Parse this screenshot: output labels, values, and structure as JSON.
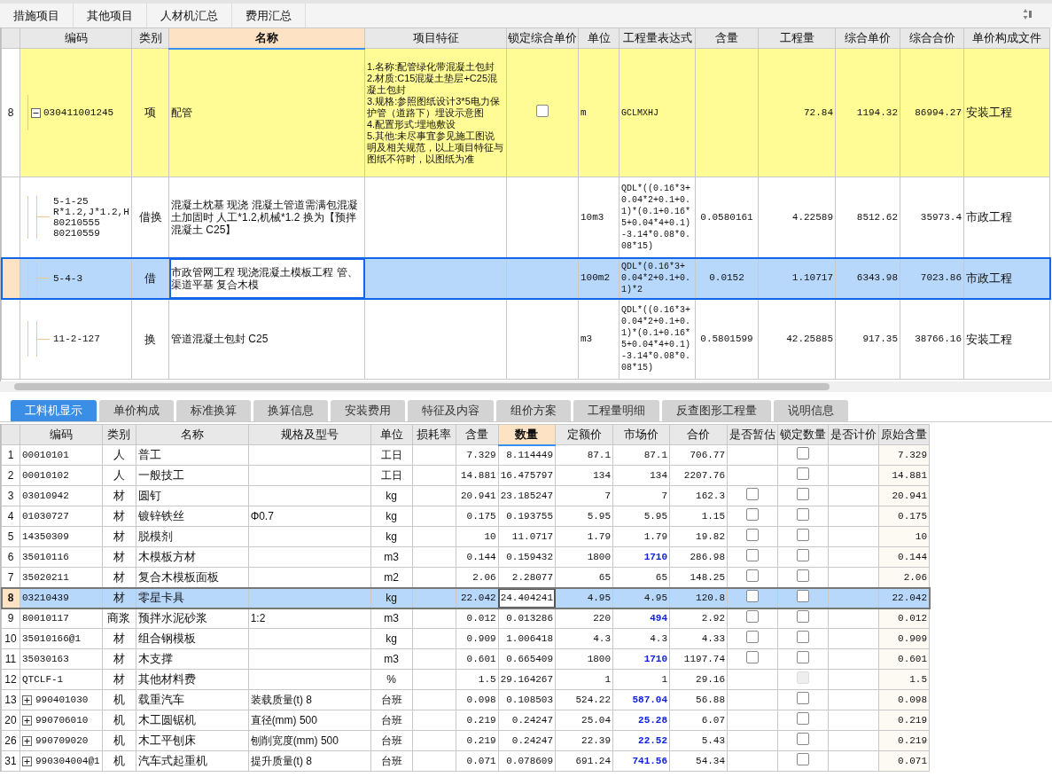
{
  "top_tabs": [
    "措施项目",
    "其他项目",
    "人材机汇总",
    "费用汇总"
  ],
  "main_table": {
    "columns": [
      {
        "label": "编码",
        "active": false
      },
      {
        "label": "类别",
        "active": false
      },
      {
        "label": "名称",
        "active": true
      },
      {
        "label": "项目特征",
        "active": false
      },
      {
        "label": "锁定综合单价",
        "active": false
      },
      {
        "label": "单位",
        "active": false
      },
      {
        "label": "工程量表达式",
        "active": false
      },
      {
        "label": "含量",
        "active": false
      },
      {
        "label": "工程量",
        "active": false
      },
      {
        "label": "综合单价",
        "active": false
      },
      {
        "label": "综合合价",
        "active": false
      },
      {
        "label": "单价构成文件",
        "active": false
      }
    ],
    "rows": [
      {
        "kind": "item",
        "selected": false,
        "row_number": "8",
        "expanded": true,
        "code": "030411001245",
        "type": "项",
        "name": "配管",
        "feature": "1.名称:配管绿化带混凝土包封\n2.材质:C15混凝土垫层+C25混凝土包封\n3.规格:参照图纸设计3*5电力保护管（道路下）埋设示意图\n4.配置形式:埋地敷设\n5.其他:未尽事宜参见施工图说明及相关规范，以上项目特征与图纸不符时，以图纸为准",
        "locked": false,
        "unit": "m",
        "expression": "GCLMXHJ",
        "quantity": "72.84",
        "unit_price": "1194.32",
        "total": "86994.27",
        "file": "安装工程"
      },
      {
        "kind": "sub",
        "selected": false,
        "code": "5-1-25\nR*1.2,J*1.2,H\n80210555\n80210559",
        "type": "借换",
        "name": "混凝土枕基 现浇  混凝土管道需满包混凝土加固时 人工*1.2,机械*1.2  换为【预拌混凝土 C25】",
        "unit": "10m3",
        "expression": "QDL*((0.16*3+0.04*2+0.1+0.1)*(0.1+0.16*5+0.04*4+0.1)-3.14*0.08*0.08*15)",
        "content": "0.0580161",
        "quantity": "4.22589",
        "unit_price": "8512.62",
        "total": "35973.4",
        "file": "市政工程"
      },
      {
        "kind": "sub",
        "selected": true,
        "code": "5-4-3",
        "type": "借",
        "name": "市政管网工程 现浇混凝土模板工程 管、渠道平基 复合木模",
        "unit": "100m2",
        "expression": "QDL*(0.16*3+0.04*2+0.1+0.1)*2",
        "content": "0.0152",
        "quantity": "1.10717",
        "unit_price": "6343.98",
        "total": "7023.86",
        "file": "市政工程"
      },
      {
        "kind": "sub",
        "selected": false,
        "code": "11-2-127",
        "type": "换",
        "name": "管道混凝土包封 C25",
        "unit": "m3",
        "expression": "QDL*((0.16*3+0.04*2+0.1+0.1)*(0.1+0.16*5+0.04*4+0.1)-3.14*0.08*0.08*15)",
        "content": "0.5801599",
        "quantity": "42.25885",
        "unit_price": "917.35",
        "total": "38766.16",
        "file": "安装工程"
      }
    ]
  },
  "detail_tabs": [
    {
      "label": "工料机显示",
      "selected": true
    },
    {
      "label": "单价构成",
      "selected": false
    },
    {
      "label": "标准换算",
      "selected": false
    },
    {
      "label": "换算信息",
      "selected": false
    },
    {
      "label": "安装费用",
      "selected": false
    },
    {
      "label": "特征及内容",
      "selected": false
    },
    {
      "label": "组价方案",
      "selected": false
    },
    {
      "label": "工程量明细",
      "selected": false
    },
    {
      "label": "反查图形工程量",
      "selected": false
    },
    {
      "label": "说明信息",
      "selected": false
    }
  ],
  "resource_table": {
    "columns": [
      {
        "label": "编码",
        "active": false
      },
      {
        "label": "类别",
        "active": false
      },
      {
        "label": "名称",
        "active": false
      },
      {
        "label": "规格及型号",
        "active": false
      },
      {
        "label": "单位",
        "active": false
      },
      {
        "label": "损耗率",
        "active": false
      },
      {
        "label": "含量",
        "active": false
      },
      {
        "label": "数量",
        "active": true
      },
      {
        "label": "定额价",
        "active": false
      },
      {
        "label": "市场价",
        "active": false
      },
      {
        "label": "合价",
        "active": false
      },
      {
        "label": "是否暂估",
        "active": false
      },
      {
        "label": "锁定数量",
        "active": false
      },
      {
        "label": "是否计价",
        "active": false
      },
      {
        "label": "原始含量",
        "active": false
      }
    ],
    "rows": [
      {
        "n": "1",
        "selected": false,
        "code": "00010101",
        "type": "人",
        "name": "普工",
        "unit": "工日",
        "content": "7.329",
        "qty": "8.114449",
        "base": "87.1",
        "market": "87.1",
        "adjusted": false,
        "total": "706.77",
        "lock_qty": false,
        "lock_disabled": false,
        "original": "7.329"
      },
      {
        "n": "2",
        "selected": false,
        "code": "00010102",
        "type": "人",
        "name": "一般技工",
        "unit": "工日",
        "content": "14.881",
        "qty": "16.475797",
        "base": "134",
        "market": "134",
        "adjusted": false,
        "total": "2207.76",
        "lock_qty": false,
        "lock_disabled": false,
        "original": "14.881"
      },
      {
        "n": "3",
        "selected": false,
        "code": "03010942",
        "type": "材",
        "name": "圆钉",
        "unit": "kg",
        "content": "20.941",
        "qty": "23.185247",
        "base": "7",
        "market": "7",
        "adjusted": false,
        "total": "162.3",
        "provisional": false,
        "lock_qty": false,
        "lock_disabled": false,
        "original": "20.941"
      },
      {
        "n": "4",
        "selected": false,
        "code": "01030727",
        "type": "材",
        "name": "镀锌铁丝",
        "spec": "Φ0.7",
        "unit": "kg",
        "content": "0.175",
        "qty": "0.193755",
        "base": "5.95",
        "market": "5.95",
        "adjusted": false,
        "total": "1.15",
        "provisional": false,
        "lock_qty": false,
        "lock_disabled": false,
        "original": "0.175"
      },
      {
        "n": "5",
        "selected": false,
        "code": "14350309",
        "type": "材",
        "name": "脱模剂",
        "unit": "kg",
        "content": "10",
        "qty": "11.0717",
        "base": "1.79",
        "market": "1.79",
        "adjusted": false,
        "total": "19.82",
        "provisional": false,
        "lock_qty": false,
        "lock_disabled": false,
        "original": "10"
      },
      {
        "n": "6",
        "selected": false,
        "code": "35010116",
        "type": "材",
        "name": "木模板方材",
        "unit": "m3",
        "content": "0.144",
        "qty": "0.159432",
        "base": "1800",
        "market": "1710",
        "adjusted": true,
        "total": "286.98",
        "provisional": false,
        "lock_qty": false,
        "lock_disabled": false,
        "original": "0.144"
      },
      {
        "n": "7",
        "selected": false,
        "code": "35020211",
        "type": "材",
        "name": "复合木模板面板",
        "unit": "m2",
        "content": "2.06",
        "qty": "2.28077",
        "base": "65",
        "market": "65",
        "adjusted": false,
        "total": "148.25",
        "provisional": false,
        "lock_qty": false,
        "lock_disabled": false,
        "original": "2.06"
      },
      {
        "n": "8",
        "selected": true,
        "code": "03210439",
        "type": "材",
        "name": "零星卡具",
        "unit": "kg",
        "content": "22.042",
        "qty": "24.404241",
        "base": "4.95",
        "market": "4.95",
        "adjusted": false,
        "total": "120.8",
        "provisional": false,
        "lock_qty": false,
        "lock_disabled": false,
        "original": "22.042"
      },
      {
        "n": "9",
        "selected": false,
        "code": "80010117",
        "type": "商浆",
        "name": "预拌水泥砂浆",
        "spec": "1:2",
        "unit": "m3",
        "content": "0.012",
        "qty": "0.013286",
        "base": "220",
        "market": "494",
        "adjusted": true,
        "total": "2.92",
        "provisional": false,
        "lock_qty": false,
        "lock_disabled": false,
        "original": "0.012"
      },
      {
        "n": "10",
        "selected": false,
        "code": "35010166@1",
        "type": "材",
        "name": "组合钢模板",
        "unit": "kg",
        "content": "0.909",
        "qty": "1.006418",
        "base": "4.3",
        "market": "4.3",
        "adjusted": false,
        "total": "4.33",
        "provisional": false,
        "lock_qty": false,
        "lock_disabled": false,
        "original": "0.909"
      },
      {
        "n": "11",
        "selected": false,
        "code": "35030163",
        "type": "材",
        "name": "木支撑",
        "unit": "m3",
        "content": "0.601",
        "qty": "0.665409",
        "base": "1800",
        "market": "1710",
        "adjusted": true,
        "total": "1197.74",
        "provisional": false,
        "lock_qty": false,
        "lock_disabled": false,
        "original": "0.601"
      },
      {
        "n": "12",
        "selected": false,
        "code": "QTCLF-1",
        "type": "材",
        "name": "其他材料费",
        "unit": "%",
        "content": "1.5",
        "qty": "29.164267",
        "base": "1",
        "market": "1",
        "adjusted": false,
        "total": "29.16",
        "lock_qty": false,
        "lock_disabled": true,
        "original": "1.5"
      },
      {
        "n": "13",
        "selected": false,
        "expanded": false,
        "code": "990401030",
        "type": "机",
        "name": "载重汽车",
        "spec": "装载质量(t)  8",
        "unit": "台班",
        "content": "0.098",
        "qty": "0.108503",
        "base": "524.22",
        "market": "587.04",
        "adjusted": true,
        "total": "56.88",
        "lock_qty": false,
        "lock_disabled": false,
        "original": "0.098"
      },
      {
        "n": "20",
        "selected": false,
        "expanded": false,
        "code": "990706010",
        "type": "机",
        "name": "木工圆锯机",
        "spec": "直径(mm)  500",
        "unit": "台班",
        "content": "0.219",
        "qty": "0.24247",
        "base": "25.04",
        "market": "25.28",
        "adjusted": true,
        "total": "6.07",
        "lock_qty": false,
        "lock_disabled": false,
        "original": "0.219"
      },
      {
        "n": "26",
        "selected": false,
        "expanded": false,
        "code": "990709020",
        "type": "机",
        "name": "木工平刨床",
        "spec": "刨削宽度(mm)  500",
        "unit": "台班",
        "content": "0.219",
        "qty": "0.24247",
        "base": "22.39",
        "market": "22.52",
        "adjusted": true,
        "total": "5.43",
        "lock_qty": false,
        "lock_disabled": false,
        "original": "0.219"
      },
      {
        "n": "31",
        "selected": false,
        "expanded": false,
        "code": "990304004@1",
        "type": "机",
        "name": "汽车式起重机",
        "spec": "提升质量(t)  8",
        "unit": "台班",
        "content": "0.071",
        "qty": "0.078609",
        "base": "691.24",
        "market": "741.56",
        "adjusted": true,
        "total": "54.34",
        "lock_qty": false,
        "lock_disabled": false,
        "original": "0.071"
      }
    ]
  }
}
